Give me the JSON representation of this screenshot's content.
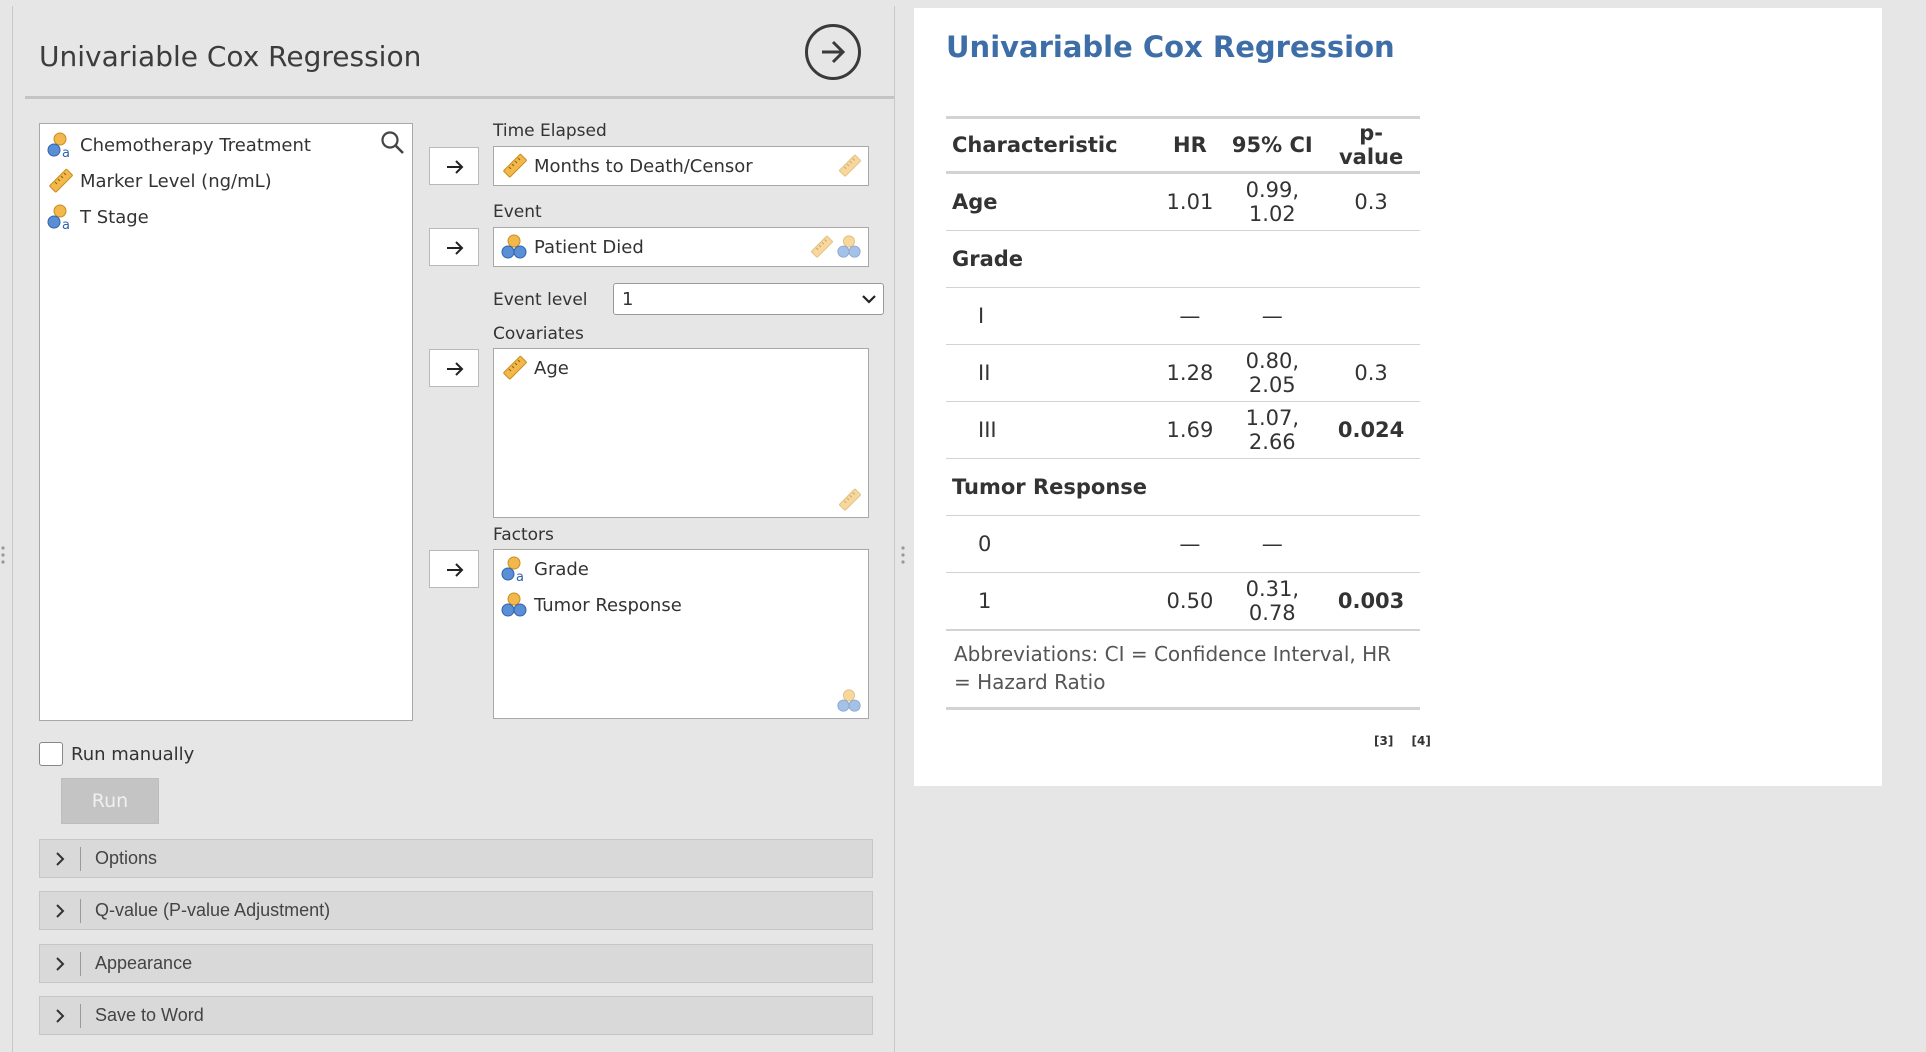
{
  "analysis": {
    "title": "Univariable Cox Regression",
    "variables": [
      {
        "label": "Chemotherapy Treatment",
        "icon": "nominal-text-icon"
      },
      {
        "label": "Marker Level (ng/mL)",
        "icon": "continuous-ruler-icon"
      },
      {
        "label": "T Stage",
        "icon": "nominal-text-icon"
      }
    ],
    "time_elapsed": {
      "label": "Time Elapsed",
      "value": "Months to Death/Censor"
    },
    "event": {
      "label": "Event",
      "value": "Patient Died"
    },
    "event_level": {
      "label": "Event level",
      "value": "1"
    },
    "covariates": {
      "label": "Covariates",
      "items": [
        "Age"
      ]
    },
    "factors": {
      "label": "Factors",
      "items": [
        "Grade",
        "Tumor Response"
      ]
    },
    "run_manually": {
      "label": "Run manually",
      "checked": false
    },
    "run_button": "Run",
    "sections": [
      "Options",
      "Q-value (P-value Adjustment)",
      "Appearance",
      "Save to Word"
    ]
  },
  "results": {
    "title": "Univariable Cox Regression",
    "columns": [
      "Characteristic",
      "HR",
      "95% CI",
      "p-value"
    ],
    "rows": [
      {
        "label": "Age",
        "kind": "group",
        "hr": "1.01",
        "ci": "0.99, 1.02",
        "p": "0.3",
        "p_bold": false
      },
      {
        "label": "Grade",
        "kind": "group",
        "hr": "",
        "ci": "",
        "p": "",
        "p_bold": false
      },
      {
        "label": "I",
        "kind": "sub",
        "hr": "—",
        "ci": "—",
        "p": "",
        "p_bold": false
      },
      {
        "label": "II",
        "kind": "sub",
        "hr": "1.28",
        "ci": "0.80, 2.05",
        "p": "0.3",
        "p_bold": false
      },
      {
        "label": "III",
        "kind": "sub",
        "hr": "1.69",
        "ci": "1.07, 2.66",
        "p": "0.024",
        "p_bold": true
      },
      {
        "label": "Tumor Response",
        "kind": "group",
        "hr": "",
        "ci": "",
        "p": "",
        "p_bold": false
      },
      {
        "label": "0",
        "kind": "sub",
        "hr": "—",
        "ci": "—",
        "p": "",
        "p_bold": false
      },
      {
        "label": "1",
        "kind": "sub",
        "hr": "0.50",
        "ci": "0.31, 0.78",
        "p": "0.003",
        "p_bold": true
      }
    ],
    "footnote": "Abbreviations: CI = Confidence Interval, HR = Hazard Ratio",
    "refs": [
      "[3]",
      "[4]"
    ]
  },
  "colors": {
    "title_blue": "#3e6ea8",
    "ruler_orange": "#f2b84b",
    "nominal_blue": "#5a8fd6"
  }
}
